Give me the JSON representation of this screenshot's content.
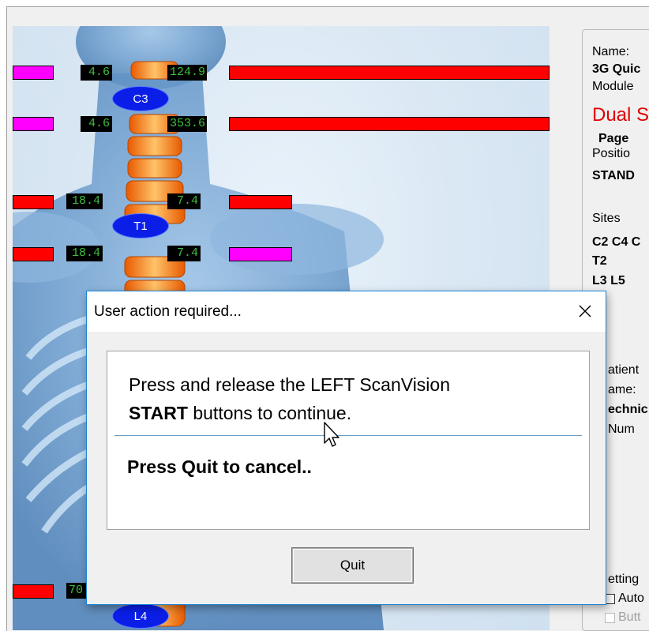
{
  "scan": {
    "rows": [
      {
        "left_value": "4.6",
        "right_value": "124.9"
      },
      {
        "left_value": "4.6",
        "right_value": "353.6"
      },
      {
        "left_value": "18.4",
        "right_value": "7.4"
      },
      {
        "left_value": "18.4",
        "right_value": "7.4"
      },
      {
        "left_value": "70"
      }
    ],
    "vertebrae": [
      "C3",
      "T1",
      "L4"
    ],
    "colors": {
      "high": "#ff0000",
      "low": "#ff00ff",
      "value_text": "#3fbf3f",
      "vertebra": "#0a1ee8"
    }
  },
  "info_panel": {
    "name_label": "Name:",
    "name_value": "3G Quic",
    "module_label": "Module",
    "module_value": "Dual S",
    "page_label": "Page",
    "position_label": "Positio",
    "position_value": "STAND",
    "sites_label": "Sites",
    "sites_line1": "C2 C4 C",
    "sites_line2": "T2",
    "sites_line3": "L3 L5",
    "patient_label": "atient",
    "patient_name_label": "ame:",
    "technician_label": "echnic",
    "number_label": "Num",
    "settings_label": "etting",
    "auto_label": "Auto",
    "button_label": "Butt"
  },
  "dialog": {
    "title": "User action required...",
    "message_line1": "Press and release the LEFT ScanVision",
    "message_line2_bold": "START",
    "message_line2_rest": " buttons to continue.",
    "message_line3": "Press Quit to cancel..",
    "quit_label": "Quit"
  }
}
